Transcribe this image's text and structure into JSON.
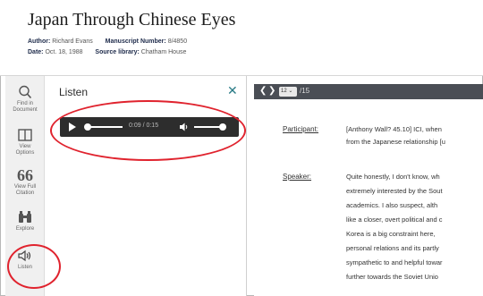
{
  "header": {
    "title": "Japan Through Chinese Eyes",
    "author_label": "Author:",
    "author_value": "Richard Evans",
    "manuscript_label": "Manuscript Number:",
    "manuscript_value": "8/4850",
    "date_label": "Date:",
    "date_value": "Oct. 18, 1988",
    "source_label": "Source library:",
    "source_value": "Chatham House"
  },
  "rail": {
    "items": [
      {
        "icon": "search-icon",
        "label_lines": [
          "Find in",
          "Document"
        ]
      },
      {
        "icon": "view-options-icon",
        "label_lines": [
          "View",
          "Options"
        ]
      },
      {
        "icon": "quote-icon",
        "label_lines": [
          "View Full",
          "Citation"
        ]
      },
      {
        "icon": "binoculars-icon",
        "label_lines": [
          "Explore"
        ]
      },
      {
        "icon": "speaker-icon",
        "label_lines": [
          "Listen"
        ]
      }
    ]
  },
  "panel": {
    "title": "Listen",
    "close_glyph": "✕"
  },
  "player": {
    "current_time": "0:09",
    "duration": "0:15",
    "progress_fraction": 0.02,
    "volume_fraction": 1.0
  },
  "doc": {
    "page_current": "12",
    "page_total": "/15",
    "prev_glyph": "❮",
    "next_glyph": "❯"
  },
  "transcript": {
    "participant_label": "Participant:",
    "participant_lines": [
      "[Anthony Wall? 45.10] ICI, when",
      "from the Japanese relationship [u"
    ],
    "speaker_label": "Speaker:",
    "speaker_lines": [
      "Quite honestly, I don't know, wh",
      "extremely interested by the Sout",
      "academics.  I also suspect, alth",
      "like a closer, overt political and c",
      "Korea is a big constraint here,",
      "personal relations and its partly",
      "sympathetic to and helpful towar",
      "further towards the Soviet Unio"
    ]
  },
  "colors": {
    "accent_teal": "#2a7b86",
    "annotation_red": "#e0232e",
    "docbar_bg": "#4a4e55",
    "player_bg": "#2d2d2d"
  }
}
